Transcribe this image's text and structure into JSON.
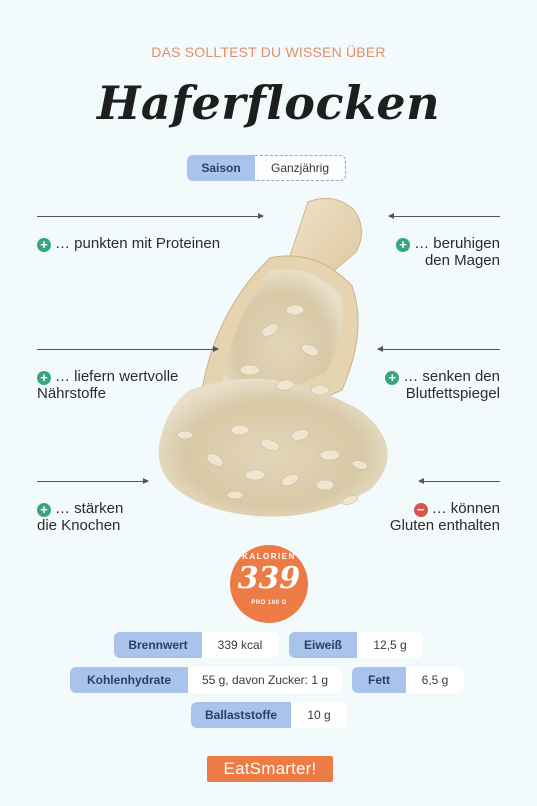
{
  "header": {
    "kicker": "DAS SOLLTEST DU WISSEN ÜBER",
    "title": "Haferflocken"
  },
  "season": {
    "label": "Saison",
    "value": "Ganzjährig"
  },
  "facts": {
    "left": [
      {
        "sign": "+",
        "line1": "… punkten mit Proteinen",
        "line2": ""
      },
      {
        "sign": "+",
        "line1": "… liefern wertvolle",
        "line2": "Nährstoffe"
      },
      {
        "sign": "+",
        "line1": "… stärken",
        "line2": "die Knochen"
      }
    ],
    "right": [
      {
        "sign": "+",
        "line1": "… beruhigen",
        "line2": "den Magen"
      },
      {
        "sign": "+",
        "line1": "… senken den",
        "line2": "Blutfettspiegel"
      },
      {
        "sign": "−",
        "line1": "… können",
        "line2": "Gluten enthalten"
      }
    ]
  },
  "calories": {
    "label": "KALORIEN",
    "value": "339",
    "per": "PRO 100 G"
  },
  "nutrition": {
    "brennwert": {
      "label": "Brennwert",
      "value": "339 kcal"
    },
    "eiweiss": {
      "label": "Eiweiß",
      "value": "12,5 g"
    },
    "kohlenhydrate": {
      "label": "Kohlenhydrate",
      "value": "55 g, davon Zucker: 1 g"
    },
    "fett": {
      "label": "Fett",
      "value": "6,5 g"
    },
    "ballaststoffe": {
      "label": "Ballaststoffe",
      "value": "10 g"
    }
  },
  "brand": {
    "logo": "EatSmarter!"
  },
  "colors": {
    "accent": "#ec7b45",
    "label_bg": "#a9c3ec",
    "plus": "#3aa57a",
    "minus": "#d9534f"
  },
  "icons": {
    "product_image": "oats-in-wooden-scoop-image"
  }
}
